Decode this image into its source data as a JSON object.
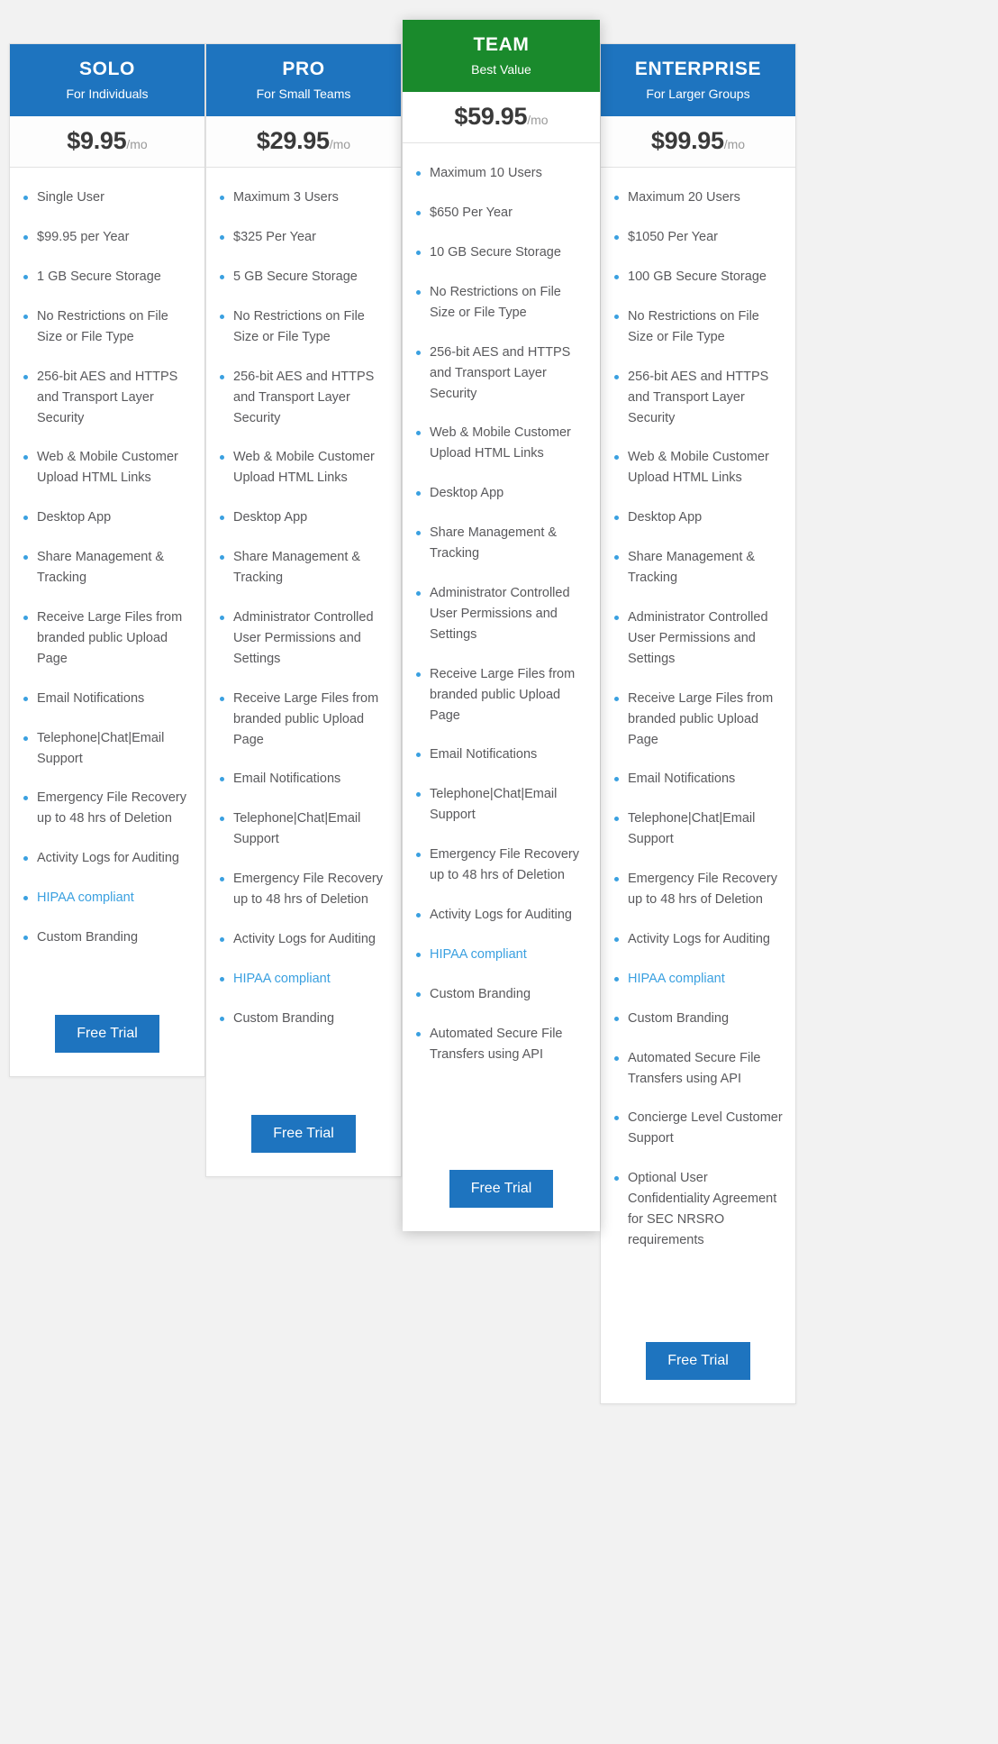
{
  "plans": [
    {
      "name": "SOLO",
      "tagline": "For Individuals",
      "price": "$9.95",
      "period": "/mo",
      "featured": false,
      "header_color": "#1e74bf",
      "cta_label": "Free Trial",
      "features": [
        {
          "text": "Single User",
          "highlight": false
        },
        {
          "text": "$99.95 per Year",
          "highlight": false
        },
        {
          "text": "1 GB Secure Storage",
          "highlight": false
        },
        {
          "text": "No Restrictions on File Size or File Type",
          "highlight": false
        },
        {
          "text": "256-bit AES and HTTPS and Transport Layer Security",
          "highlight": false
        },
        {
          "text": "Web & Mobile Customer Upload HTML Links",
          "highlight": false
        },
        {
          "text": "Desktop App",
          "highlight": false
        },
        {
          "text": "Share Management & Tracking",
          "highlight": false
        },
        {
          "text": "Receive Large Files from branded public Upload Page",
          "highlight": false
        },
        {
          "text": "Email Notifications",
          "highlight": false
        },
        {
          "text": "Telephone|Chat|Email Support",
          "highlight": false
        },
        {
          "text": "Emergency File Recovery up to 48 hrs of Deletion",
          "highlight": false
        },
        {
          "text": "Activity Logs for Auditing",
          "highlight": false
        },
        {
          "text": "HIPAA compliant",
          "highlight": true
        },
        {
          "text": "Custom Branding",
          "highlight": false
        }
      ]
    },
    {
      "name": "PRO",
      "tagline": "For Small Teams",
      "price": "$29.95",
      "period": "/mo",
      "featured": false,
      "header_color": "#1e74bf",
      "cta_label": "Free Trial",
      "features": [
        {
          "text": "Maximum 3 Users",
          "highlight": false
        },
        {
          "text": "$325 Per Year",
          "highlight": false
        },
        {
          "text": "5 GB Secure Storage",
          "highlight": false
        },
        {
          "text": "No Restrictions on File Size or File Type",
          "highlight": false
        },
        {
          "text": "256-bit AES and HTTPS and Transport Layer Security",
          "highlight": false
        },
        {
          "text": "Web & Mobile Customer Upload HTML Links",
          "highlight": false
        },
        {
          "text": "Desktop App",
          "highlight": false
        },
        {
          "text": "Share Management & Tracking",
          "highlight": false
        },
        {
          "text": "Administrator Controlled User Permissions and Settings",
          "highlight": false
        },
        {
          "text": "Receive Large Files from branded public Upload Page",
          "highlight": false
        },
        {
          "text": "Email Notifications",
          "highlight": false
        },
        {
          "text": "Telephone|Chat|Email Support",
          "highlight": false
        },
        {
          "text": "Emergency File Recovery up to 48 hrs of Deletion",
          "highlight": false
        },
        {
          "text": "Activity Logs for Auditing",
          "highlight": false
        },
        {
          "text": "HIPAA compliant",
          "highlight": true
        },
        {
          "text": "Custom Branding",
          "highlight": false
        }
      ]
    },
    {
      "name": "TEAM",
      "tagline": "Best Value",
      "price": "$59.95",
      "period": "/mo",
      "featured": true,
      "header_color": "#1a8a2c",
      "cta_label": "Free Trial",
      "features": [
        {
          "text": "Maximum 10 Users",
          "highlight": false
        },
        {
          "text": "$650 Per Year",
          "highlight": false
        },
        {
          "text": "10 GB Secure Storage",
          "highlight": false
        },
        {
          "text": "No Restrictions on File Size or File Type",
          "highlight": false
        },
        {
          "text": "256-bit AES and HTTPS and Transport Layer Security",
          "highlight": false
        },
        {
          "text": "Web & Mobile Customer Upload HTML Links",
          "highlight": false
        },
        {
          "text": "Desktop App",
          "highlight": false
        },
        {
          "text": "Share Management & Tracking",
          "highlight": false
        },
        {
          "text": "Administrator Controlled User Permissions and Settings",
          "highlight": false
        },
        {
          "text": "Receive Large Files from branded public Upload Page",
          "highlight": false
        },
        {
          "text": "Email Notifications",
          "highlight": false
        },
        {
          "text": "Telephone|Chat|Email Support",
          "highlight": false
        },
        {
          "text": "Emergency File Recovery up to 48 hrs of Deletion",
          "highlight": false
        },
        {
          "text": "Activity Logs for Auditing",
          "highlight": false
        },
        {
          "text": "HIPAA compliant",
          "highlight": true
        },
        {
          "text": "Custom Branding",
          "highlight": false
        },
        {
          "text": "Automated Secure File Transfers using API",
          "highlight": false
        }
      ]
    },
    {
      "name": "ENTERPRISE",
      "tagline": "For Larger Groups",
      "price": "$99.95",
      "period": "/mo",
      "featured": false,
      "header_color": "#1e74bf",
      "cta_label": "Free Trial",
      "features": [
        {
          "text": "Maximum 20 Users",
          "highlight": false
        },
        {
          "text": "$1050 Per Year",
          "highlight": false
        },
        {
          "text": "100 GB Secure Storage",
          "highlight": false
        },
        {
          "text": "No Restrictions on File Size or File Type",
          "highlight": false
        },
        {
          "text": "256-bit AES and HTTPS and Transport Layer Security",
          "highlight": false
        },
        {
          "text": "Web & Mobile Customer Upload HTML Links",
          "highlight": false
        },
        {
          "text": "Desktop App",
          "highlight": false
        },
        {
          "text": "Share Management & Tracking",
          "highlight": false
        },
        {
          "text": "Administrator Controlled User Permissions and Settings",
          "highlight": false
        },
        {
          "text": "Receive Large Files from branded public Upload Page",
          "highlight": false
        },
        {
          "text": "Email Notifications",
          "highlight": false
        },
        {
          "text": "Telephone|Chat|Email Support",
          "highlight": false
        },
        {
          "text": "Emergency File Recovery up to 48 hrs of Deletion",
          "highlight": false
        },
        {
          "text": "Activity Logs for Auditing",
          "highlight": false
        },
        {
          "text": "HIPAA compliant",
          "highlight": true
        },
        {
          "text": "Custom Branding",
          "highlight": false
        },
        {
          "text": "Automated Secure File Transfers using API",
          "highlight": false
        },
        {
          "text": "Concierge Level Customer Support",
          "highlight": false
        },
        {
          "text": "Optional User Confidentiality Agreement for SEC NRSRO requirements",
          "highlight": false
        }
      ]
    }
  ]
}
